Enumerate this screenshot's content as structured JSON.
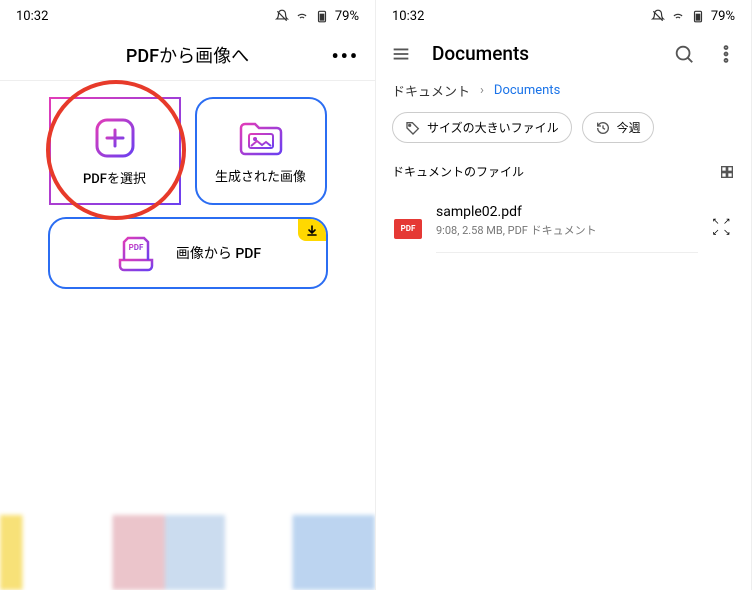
{
  "status": {
    "time": "10:32",
    "battery": "79%"
  },
  "left": {
    "title": "PDFから画像へ",
    "card_select": "PDFを選択",
    "card_generated": "生成された画像",
    "card_img2pdf": "画像から PDF"
  },
  "right": {
    "title": "Documents",
    "breadcrumb": {
      "root": "ドキュメント",
      "current": "Documents"
    },
    "chip_size": "サイズの大きいファイル",
    "chip_week": "今週",
    "section": "ドキュメントのファイル",
    "file": {
      "name": "sample02.pdf",
      "meta": "9:08, 2.58 MB, PDF ドキュメント",
      "badge": "PDF"
    }
  }
}
